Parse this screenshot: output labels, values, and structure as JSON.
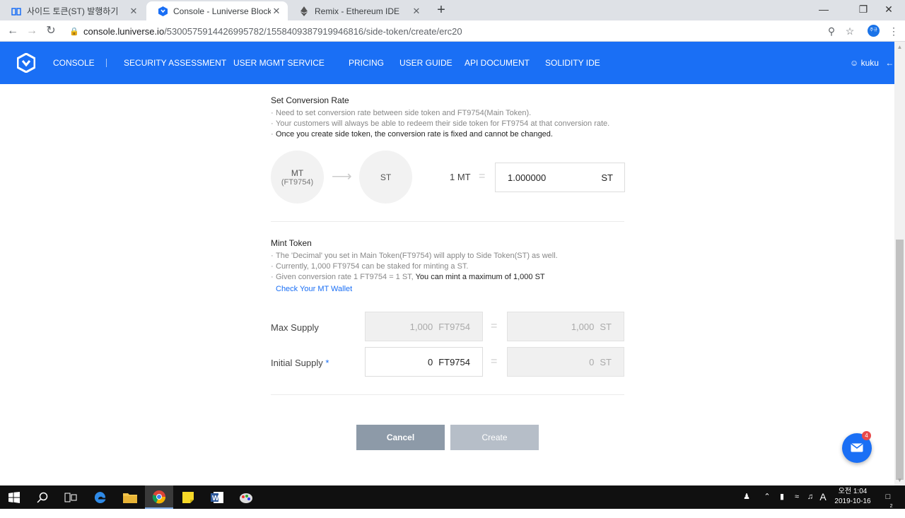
{
  "browser": {
    "tabs": [
      {
        "title": "사이드 토큰(ST) 발행하기",
        "close": "✕"
      },
      {
        "title": "Console - Luniverse Blockchain",
        "close": "✕"
      },
      {
        "title": "Remix - Ethereum IDE",
        "close": "✕"
      }
    ],
    "new_tab": "+",
    "url_host": "console.luniverse.io",
    "url_path": "/530057591442699578​2/1558409387919946816/side-token/create/erc20",
    "profile_initial": "주규"
  },
  "nav": {
    "items": [
      "CONSOLE",
      "SECURITY ASSESSMENT",
      "USER MGMT SERVICE",
      "PRICING",
      "USER GUIDE",
      "API DOCUMENT",
      "SOLIDITY IDE"
    ],
    "user": "kuku",
    "accent": "#1a6ff5"
  },
  "conversion": {
    "title": "Set Conversion Rate",
    "notes": [
      "Need to set conversion rate between side token and FT9754(Main Token).",
      "Your customers will always be able to redeem their side token for FT9754 at that conversion rate."
    ],
    "note_strong": "Once you create side token, the conversion rate is fixed and cannot be changed.",
    "main_symbol": "MT",
    "main_name": "(FT9754)",
    "side_symbol": "ST",
    "rate_label": "1 MT",
    "equals": "=",
    "rate_value": "1.000000",
    "rate_unit": "ST"
  },
  "mint": {
    "title": "Mint Token",
    "notes": [
      "The 'Decimal' you set in Main Token(FT9754) will apply to Side Token(ST) as well.",
      "Currently, 1,000 FT9754 can be staked for minting a ST."
    ],
    "note3_gray": "Given conversion rate 1 FT9754 = 1 ST,",
    "note3_dark": " You can mint a maximum of 1,000 ST",
    "wallet_link": "Check Your MT Wallet",
    "max_supply_label": "Max Supply",
    "max_supply_main": "1,000",
    "max_supply_main_unit": "FT9754",
    "max_supply_side": "1,000",
    "max_supply_side_unit": "ST",
    "initial_supply_label": "Initial Supply",
    "required_mark": "*",
    "initial_supply_main": "0",
    "initial_supply_main_unit": "FT9754",
    "initial_supply_side": "0",
    "initial_supply_side_unit": "ST",
    "equals": "="
  },
  "actions": {
    "cancel": "Cancel",
    "create": "Create"
  },
  "chat": {
    "badge": "4"
  },
  "taskbar": {
    "ime": "A",
    "clock_period": "오전 1:04",
    "clock_date": "2019-10-16",
    "notifications": "2"
  }
}
